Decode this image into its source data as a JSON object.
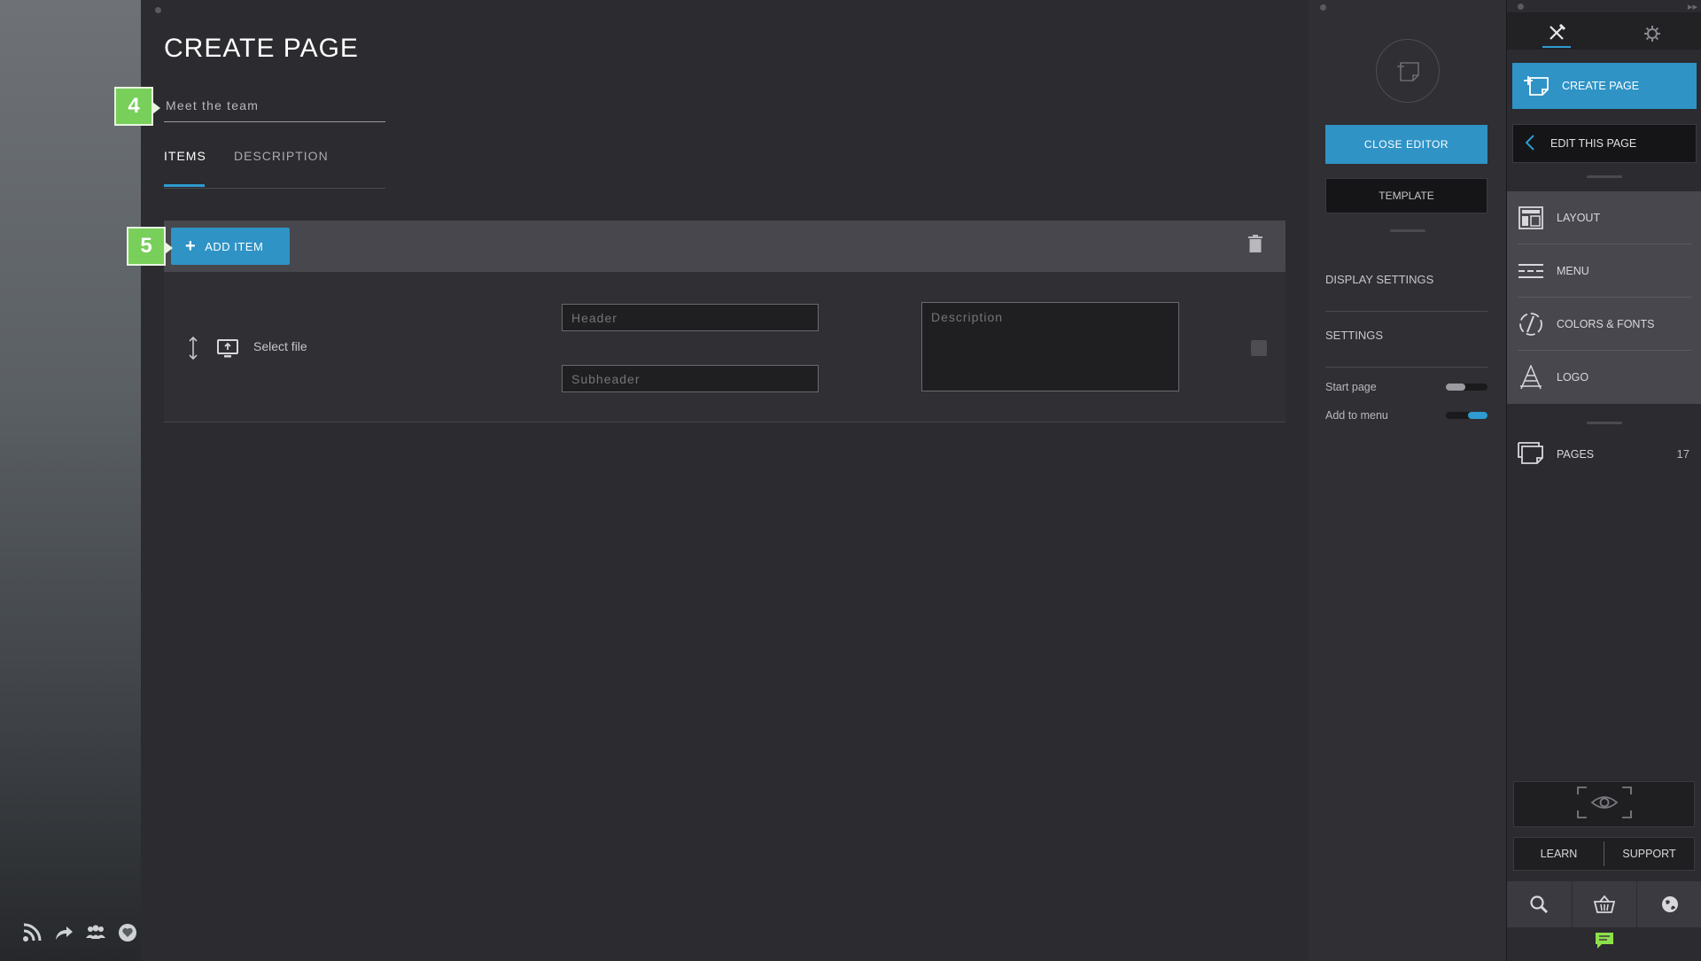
{
  "editor": {
    "title": "CREATE PAGE",
    "page_name_value": "Meet the team",
    "tabs": [
      {
        "label": "ITEMS",
        "active": true
      },
      {
        "label": "DESCRIPTION",
        "active": false
      }
    ],
    "add_item_label": "ADD ITEM",
    "item": {
      "select_file_label": "Select file",
      "header_placeholder": "Header",
      "subheader_placeholder": "Subheader",
      "description_placeholder": "Description"
    }
  },
  "badges": {
    "step_4": "4",
    "step_5": "5"
  },
  "settings_panel": {
    "close_editor_label": "CLOSE EDITOR",
    "template_label": "TEMPLATE",
    "display_settings_label": "DISPLAY SETTINGS",
    "settings_label": "SETTINGS",
    "start_page_label": "Start page",
    "start_page_on": false,
    "add_to_menu_label": "Add to menu",
    "add_to_menu_on": true
  },
  "tools_panel": {
    "create_page_label": "CREATE PAGE",
    "edit_this_page_label": "EDIT THIS PAGE",
    "items": [
      {
        "label": "LAYOUT",
        "icon": "layout-icon"
      },
      {
        "label": "MENU",
        "icon": "menu-lines-icon"
      },
      {
        "label": "COLORS & FONTS",
        "icon": "colors-fonts-icon"
      },
      {
        "label": "LOGO",
        "icon": "logo-icon"
      }
    ],
    "pages_label": "PAGES",
    "pages_count": "17",
    "learn_label": "LEARN",
    "support_label": "SUPPORT"
  },
  "colors": {
    "accent_blue": "#2f93c6",
    "badge_green": "#78cf5a",
    "chat_green": "#8ee04a"
  }
}
